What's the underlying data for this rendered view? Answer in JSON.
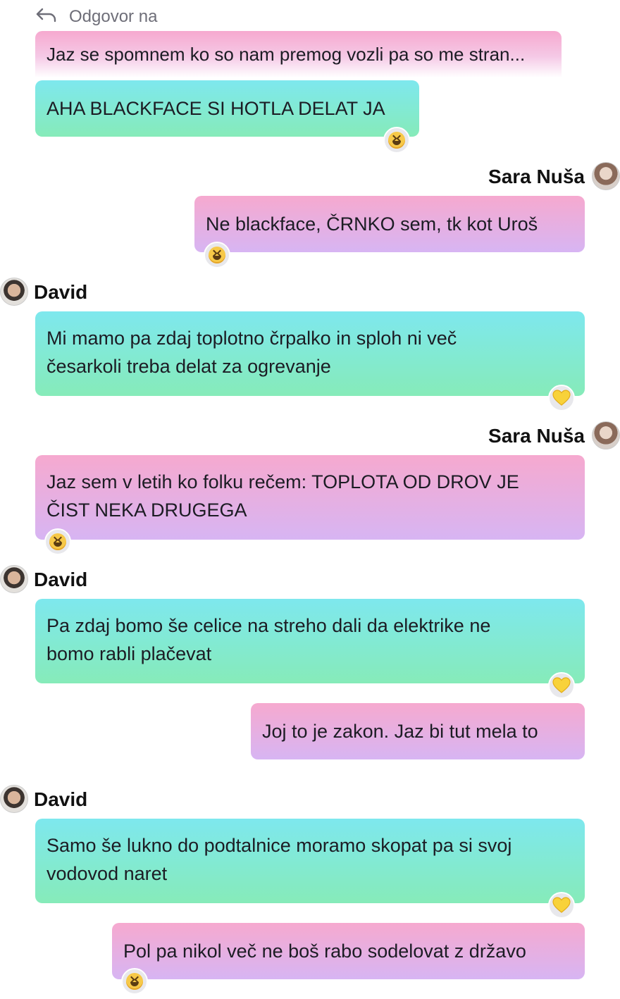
{
  "reply": {
    "label": "Odgovor na",
    "quoted_text": "Jaz se spomnem ko so nam premog vozli pa so me stran..."
  },
  "messages": [
    {
      "sender": "",
      "text": "AHA BLACKFACE SI HOTLA DELAT JA",
      "reaction": "grinning-squinting-face"
    },
    {
      "sender": "Sara Nuša",
      "text": "Ne blackface, ČRNKO sem, tk kot Uroš",
      "reaction": "grinning-squinting-face"
    },
    {
      "sender": "David",
      "text_line1": "Mi mamo pa zdaj toplotno črpalko in sploh ni več",
      "text_line2": "česarkoli treba delat za ogrevanje",
      "reaction": "yellow-heart"
    },
    {
      "sender": "Sara Nuša",
      "text_line1": "Jaz sem v letih ko folku rečem: TOPLOTA OD DROV JE",
      "text_line2": "ČIST NEKA DRUGEGA",
      "reaction": "grinning-squinting-face"
    },
    {
      "sender": "David",
      "text_line1": "Pa zdaj bomo še celice na streho dali da elektrike ne",
      "text_line2": "bomo rabli plačevat",
      "reaction": "yellow-heart"
    },
    {
      "sender": "",
      "text": "Joj to je zakon. Jaz bi tut mela to",
      "reaction": ""
    },
    {
      "sender": "David",
      "text_line1": "Samo še lukno do podtalnice moramo skopat pa si svoj",
      "text_line2": "vodovod naret",
      "reaction": "yellow-heart"
    },
    {
      "sender": "",
      "text": "Pol pa nikol več ne boš rabo sodelovat z državo",
      "reaction": "grinning-squinting-face"
    }
  ],
  "colors": {
    "teal_top": "#7ee8ee",
    "teal_bottom": "#86ebb9",
    "pink_top": "#f6a9cf",
    "pink_bottom": "#d7b5f3"
  }
}
